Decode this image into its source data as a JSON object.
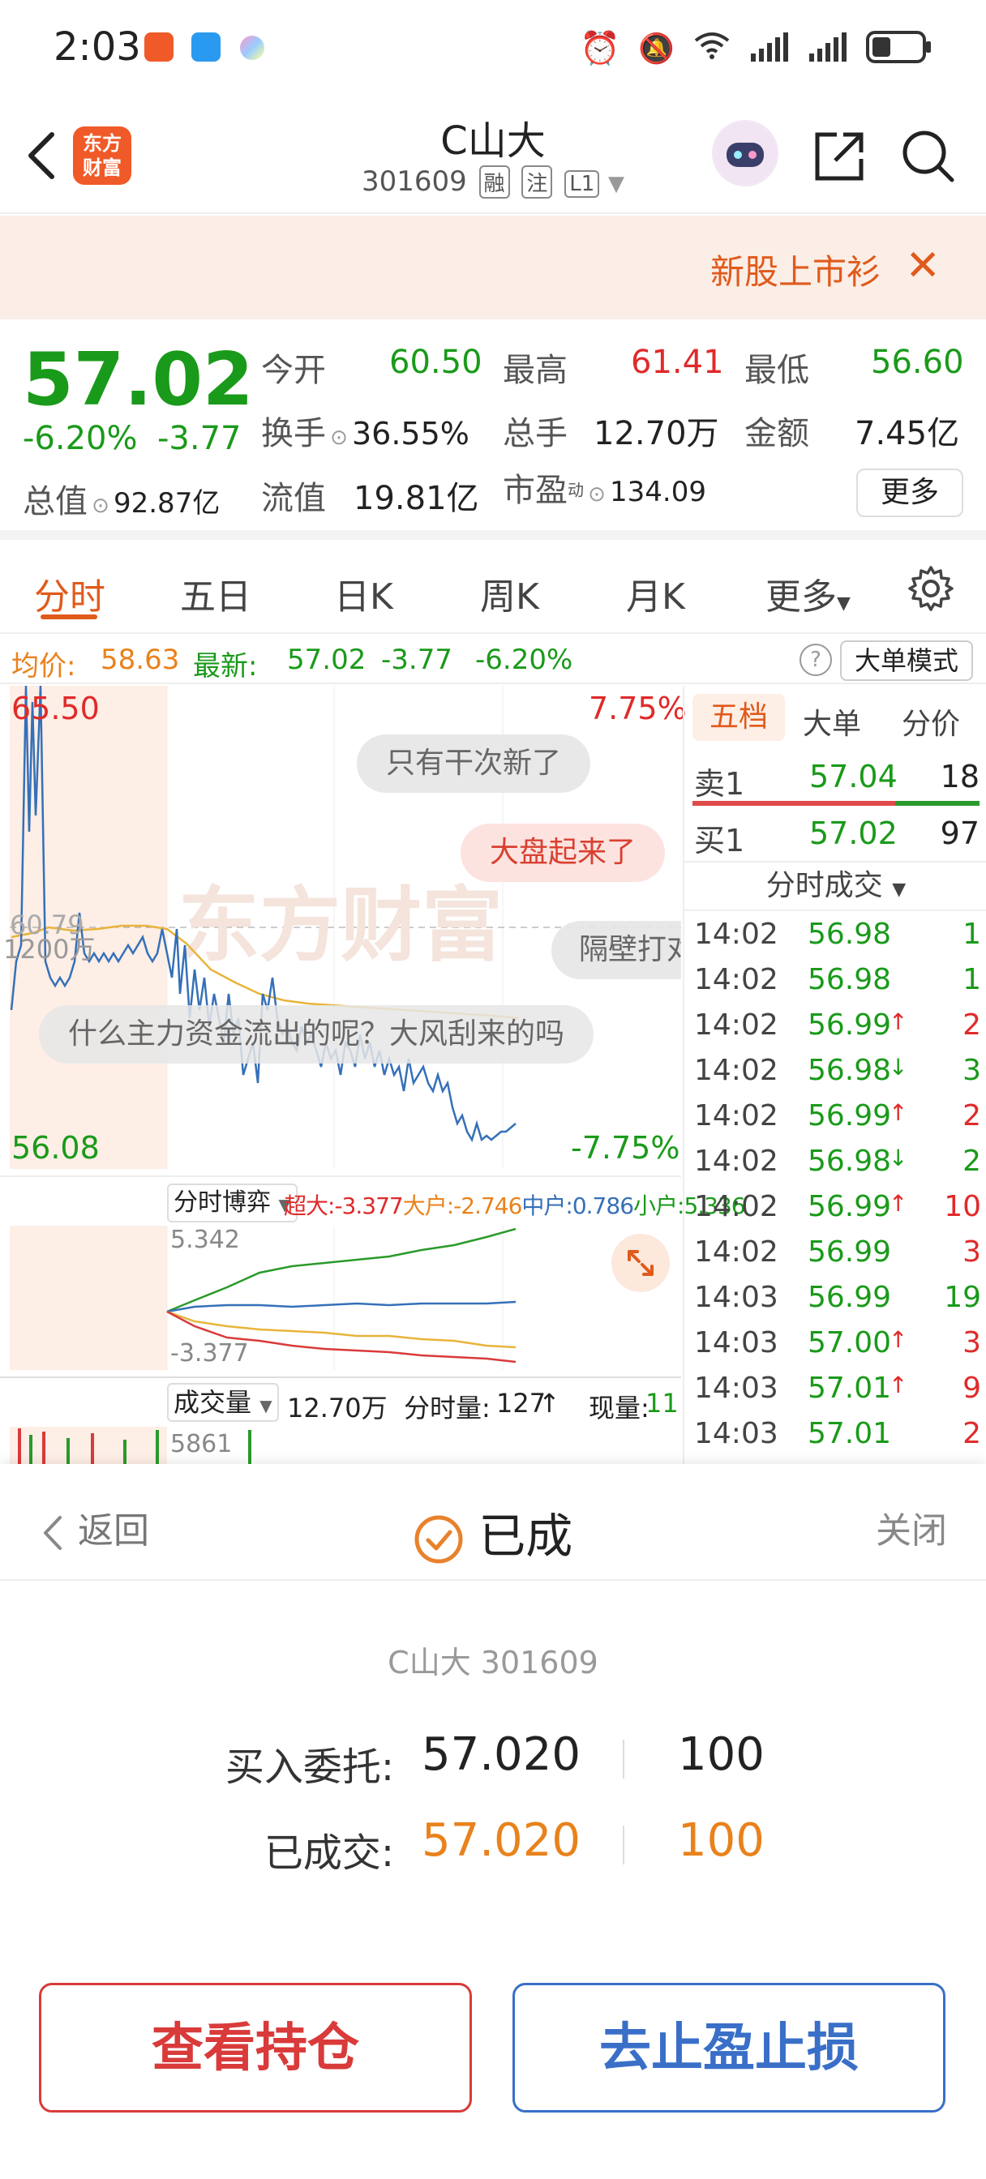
{
  "status_bar": {
    "time": "2:03",
    "signal_label": "6"
  },
  "header": {
    "logo_line1": "东方",
    "logo_line2": "财富",
    "stock_name": "C山大",
    "stock_code": "301609",
    "tags": [
      "融",
      "注",
      "L1"
    ]
  },
  "banner": {
    "text": "新股上市衫",
    "close": "✕"
  },
  "quote": {
    "price": "57.02",
    "change_pct": "-6.20%",
    "change_amt": "-3.77",
    "open_label": "今开",
    "open": "60.50",
    "high_label": "最高",
    "high": "61.41",
    "low_label": "最低",
    "low": "56.60",
    "turnover_label": "换手",
    "turnover": "36.55%",
    "volume_label": "总手",
    "volume": "12.70万",
    "amount_label": "金额",
    "amount": "7.45亿",
    "mktcap_label": "总值",
    "mktcap": "92.87亿",
    "float_label": "流值",
    "float": "19.81亿",
    "pe_label": "市盈",
    "pe_sup": "动",
    "pe": "134.09",
    "more": "更多"
  },
  "tabs": [
    "分时",
    "五日",
    "日K",
    "周K",
    "月K",
    "更多"
  ],
  "avg_row": {
    "avg_label": "均价:",
    "avg": "58.63",
    "latest_label": "最新:",
    "latest": "57.02",
    "chg": "-3.77",
    "pct": "-6.20%",
    "help": "?",
    "bigorder": "大单模式"
  },
  "chart": {
    "top_price": "65.50",
    "top_pct": "7.75%",
    "bottom_price": "56.08",
    "bottom_pct": "-7.75%",
    "mid_price": "60.79",
    "mid_vol": "1200万",
    "watermark": "东方财富",
    "comments": [
      "只有干次新了",
      "大盘起来了",
      "隔壁打对",
      "什么主力资金流出的呢？大风刮来的吗"
    ]
  },
  "subchart": {
    "label": "分时博弈",
    "super_label": "超大:",
    "super": "-3.377",
    "big_label": "大户:",
    "big": "-2.746",
    "mid_label": "中户:",
    "mid": "0.786",
    "small_label": "小户:",
    "small": "5.336",
    "max": "5.342",
    "min": "-3.377"
  },
  "volume": {
    "label": "成交量",
    "total": "12.70万",
    "tick_label": "分时量:",
    "tick": "127",
    "now_label": "现量:",
    "now": "11",
    "scale": "5861"
  },
  "order_book": {
    "tabs": [
      "五档",
      "大单",
      "分价"
    ],
    "sell1_label": "卖1",
    "sell1_price": "57.04",
    "sell1_qty": "18",
    "buy1_label": "买1",
    "buy1_price": "57.02",
    "buy1_qty": "97",
    "trades_title": "分时成交",
    "trades": [
      {
        "time": "14:02",
        "price": "56.98",
        "arrow": "",
        "qty": "1",
        "color": "#1a9a1a",
        "qcolor": "#1a9a1a"
      },
      {
        "time": "14:02",
        "price": "56.98",
        "arrow": "",
        "qty": "1",
        "color": "#1a9a1a",
        "qcolor": "#1a9a1a"
      },
      {
        "time": "14:02",
        "price": "56.99",
        "arrow": "↑",
        "qty": "2",
        "color": "#1a9a1a",
        "qcolor": "#e02a2a"
      },
      {
        "time": "14:02",
        "price": "56.98",
        "arrow": "↓",
        "qty": "3",
        "color": "#1a9a1a",
        "qcolor": "#1a9a1a"
      },
      {
        "time": "14:02",
        "price": "56.99",
        "arrow": "↑",
        "qty": "2",
        "color": "#1a9a1a",
        "qcolor": "#e02a2a"
      },
      {
        "time": "14:02",
        "price": "56.98",
        "arrow": "↓",
        "qty": "2",
        "color": "#1a9a1a",
        "qcolor": "#1a9a1a"
      },
      {
        "time": "14:02",
        "price": "56.99",
        "arrow": "↑",
        "qty": "10",
        "color": "#1a9a1a",
        "qcolor": "#e02a2a"
      },
      {
        "time": "14:02",
        "price": "56.99",
        "arrow": "",
        "qty": "3",
        "color": "#1a9a1a",
        "qcolor": "#e02a2a"
      },
      {
        "time": "14:03",
        "price": "56.99",
        "arrow": "",
        "qty": "19",
        "color": "#1a9a1a",
        "qcolor": "#1a9a1a"
      },
      {
        "time": "14:03",
        "price": "57.00",
        "arrow": "↑",
        "qty": "3",
        "color": "#1a9a1a",
        "qcolor": "#e02a2a"
      },
      {
        "time": "14:03",
        "price": "57.01",
        "arrow": "↑",
        "qty": "9",
        "color": "#1a9a1a",
        "qcolor": "#e02a2a"
      },
      {
        "time": "14:03",
        "price": "57.01",
        "arrow": "",
        "qty": "2",
        "color": "#1a9a1a",
        "qcolor": "#e02a2a"
      }
    ]
  },
  "sheet": {
    "back": "返回",
    "title": "已成",
    "close": "关闭",
    "stock": "C山大 301609",
    "order_label": "买入委托:",
    "order_price": "57.020",
    "order_qty": "100",
    "filled_label": "已成交:",
    "filled_price": "57.020",
    "filled_qty": "100",
    "btn_position": "查看持仓",
    "btn_stop": "去止盈止损"
  }
}
